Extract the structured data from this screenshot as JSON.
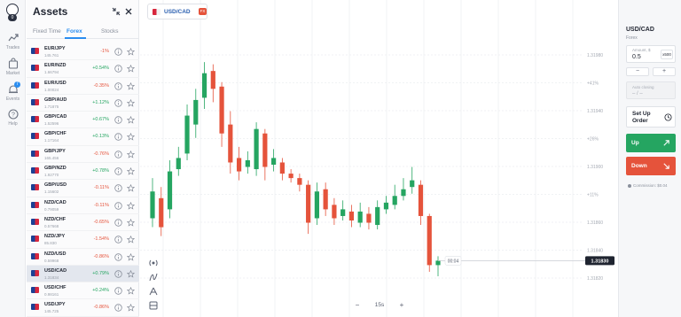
{
  "nav": {
    "avatar_badge": "0",
    "items": [
      {
        "label": "Trades",
        "icon": "trades-icon"
      },
      {
        "label": "Market",
        "icon": "market-icon"
      },
      {
        "label": "Events",
        "icon": "events-icon",
        "badge": "7"
      },
      {
        "label": "Help",
        "icon": "help-icon"
      }
    ]
  },
  "assets": {
    "title": "Assets",
    "tabs": [
      "Fixed Time",
      "Forex",
      "Stocks"
    ],
    "active_tab": "Forex",
    "rows": [
      {
        "pair": "EUR/JPY",
        "price": "145.761",
        "change": "-1%",
        "dir": "down"
      },
      {
        "pair": "EUR/NZD",
        "price": "1.66794",
        "change": "+0.54%",
        "dir": "up"
      },
      {
        "pair": "EUR/USD",
        "price": "1.00024",
        "change": "-0.35%",
        "dir": "down"
      },
      {
        "pair": "GBP/AUD",
        "price": "1.71875",
        "change": "+1.12%",
        "dir": "up"
      },
      {
        "pair": "GBP/CAD",
        "price": "1.52596",
        "change": "+0.67%",
        "dir": "up"
      },
      {
        "pair": "GBP/CHF",
        "price": "1.17164",
        "change": "+0.13%",
        "dir": "up"
      },
      {
        "pair": "GBP/JPY",
        "price": "165.456",
        "change": "-0.76%",
        "dir": "down"
      },
      {
        "pair": "GBP/NZD",
        "price": "1.92770",
        "change": "+0.78%",
        "dir": "up"
      },
      {
        "pair": "GBP/USD",
        "price": "1.15602",
        "change": "-0.11%",
        "dir": "down"
      },
      {
        "pair": "NZD/CAD",
        "price": "0.79059",
        "change": "-0.11%",
        "dir": "down"
      },
      {
        "pair": "NZD/CHF",
        "price": "0.57668",
        "change": "-0.65%",
        "dir": "down"
      },
      {
        "pair": "NZD/JPY",
        "price": "85.830",
        "change": "-1.54%",
        "dir": "down"
      },
      {
        "pair": "NZD/USD",
        "price": "0.59968",
        "change": "-0.86%",
        "dir": "down"
      },
      {
        "pair": "USD/CAD",
        "price": "1.31834",
        "change": "+0.79%",
        "dir": "up",
        "selected": true
      },
      {
        "pair": "USD/CHF",
        "price": "0.98161",
        "change": "+0.24%",
        "dir": "up"
      },
      {
        "pair": "USD/JPY",
        "price": "145.725",
        "change": "-0.86%",
        "dir": "down"
      }
    ]
  },
  "chart": {
    "active_pair": "USD/CAD",
    "active_badge": "FX",
    "timer": "00:04",
    "current_price": "1.31830",
    "timeframe": "15s",
    "tools": [
      "signal-icon",
      "indicators-icon",
      "drawing-icon",
      "layout-icon"
    ],
    "colors": {
      "up": "#25a561",
      "down": "#e5533b"
    }
  },
  "chart_data": {
    "type": "candlestick",
    "y_ticks": [
      "1.31980",
      "+41%",
      "1.31940",
      "+26%",
      "1.31900",
      "+11%",
      "1.31860",
      "1.31840",
      "1.31820"
    ],
    "current_price": "1.31830",
    "candles": [
      {
        "o": 0.26,
        "c": 0.38,
        "h": 0.44,
        "l": 0.22
      },
      {
        "o": 0.35,
        "c": 0.22,
        "h": 0.4,
        "l": 0.18
      },
      {
        "o": 0.3,
        "c": 0.47,
        "h": 0.52,
        "l": 0.26
      },
      {
        "o": 0.48,
        "c": 0.53,
        "h": 0.58,
        "l": 0.45
      },
      {
        "o": 0.55,
        "c": 0.72,
        "h": 0.77,
        "l": 0.52
      },
      {
        "o": 0.68,
        "c": 0.79,
        "h": 0.84,
        "l": 0.62
      },
      {
        "o": 0.8,
        "c": 0.91,
        "h": 0.96,
        "l": 0.75
      },
      {
        "o": 0.92,
        "c": 0.84,
        "h": 0.95,
        "l": 0.78
      },
      {
        "o": 0.85,
        "c": 0.64,
        "h": 0.87,
        "l": 0.58
      },
      {
        "o": 0.68,
        "c": 0.51,
        "h": 0.74,
        "l": 0.46
      },
      {
        "o": 0.53,
        "c": 0.47,
        "h": 0.58,
        "l": 0.43
      },
      {
        "o": 0.49,
        "c": 0.52,
        "h": 0.56,
        "l": 0.46
      },
      {
        "o": 0.48,
        "c": 0.66,
        "h": 0.69,
        "l": 0.45
      },
      {
        "o": 0.64,
        "c": 0.49,
        "h": 0.66,
        "l": 0.43
      },
      {
        "o": 0.5,
        "c": 0.53,
        "h": 0.57,
        "l": 0.47
      },
      {
        "o": 0.51,
        "c": 0.46,
        "h": 0.53,
        "l": 0.43
      },
      {
        "o": 0.46,
        "c": 0.44,
        "h": 0.48,
        "l": 0.42
      },
      {
        "o": 0.44,
        "c": 0.41,
        "h": 0.46,
        "l": 0.38
      },
      {
        "o": 0.41,
        "c": 0.24,
        "h": 0.43,
        "l": 0.19
      },
      {
        "o": 0.26,
        "c": 0.38,
        "h": 0.42,
        "l": 0.23
      },
      {
        "o": 0.39,
        "c": 0.3,
        "h": 0.42,
        "l": 0.27
      },
      {
        "o": 0.32,
        "c": 0.26,
        "h": 0.35,
        "l": 0.23
      },
      {
        "o": 0.27,
        "c": 0.3,
        "h": 0.34,
        "l": 0.25
      },
      {
        "o": 0.29,
        "c": 0.25,
        "h": 0.32,
        "l": 0.22
      },
      {
        "o": 0.24,
        "c": 0.29,
        "h": 0.33,
        "l": 0.22
      },
      {
        "o": 0.28,
        "c": 0.24,
        "h": 0.31,
        "l": 0.21
      },
      {
        "o": 0.23,
        "c": 0.31,
        "h": 0.34,
        "l": 0.21
      },
      {
        "o": 0.3,
        "c": 0.33,
        "h": 0.36,
        "l": 0.28
      },
      {
        "o": 0.32,
        "c": 0.36,
        "h": 0.41,
        "l": 0.3
      },
      {
        "o": 0.36,
        "c": 0.39,
        "h": 0.44,
        "l": 0.34
      },
      {
        "o": 0.4,
        "c": 0.43,
        "h": 0.49,
        "l": 0.37
      },
      {
        "o": 0.41,
        "c": 0.27,
        "h": 0.43,
        "l": 0.23
      },
      {
        "o": 0.27,
        "c": 0.05,
        "h": 0.28,
        "l": 0.02
      },
      {
        "o": 0.05,
        "c": 0.07,
        "h": 0.09,
        "l": 0.0
      }
    ]
  },
  "trade": {
    "symbol": "USD/CAD",
    "category": "Forex",
    "amount_label": "Amount, $",
    "amount_value": "0.5",
    "multiplier": "x500",
    "minus": "−",
    "plus": "+",
    "autoclose_label": "Auto closing",
    "autoclose_value": "– / –",
    "setup_order": "Set Up Order",
    "up_label": "Up",
    "down_label": "Down",
    "commission": "Commission: $0.04"
  }
}
